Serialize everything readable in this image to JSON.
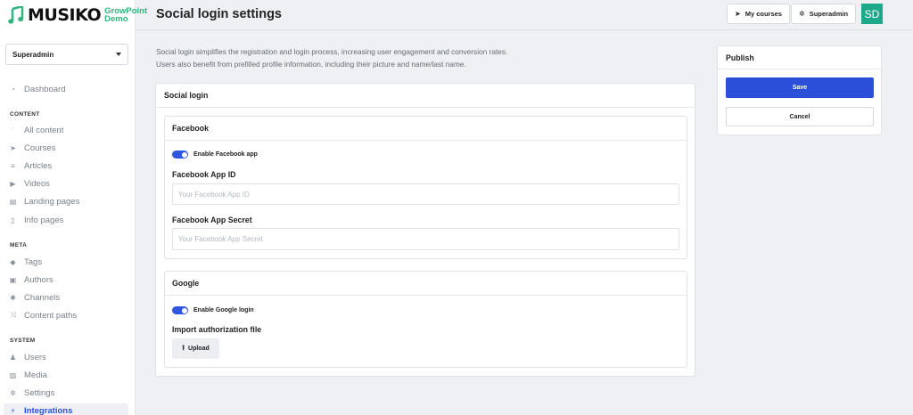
{
  "brand": {
    "name": "MUSIKO",
    "sub1": "GrowPoint",
    "sub2": "Demo"
  },
  "workspace": {
    "selected": "Superadmin"
  },
  "nav": {
    "dashboard": {
      "label": "Dashboard",
      "icon": "dashboard-icon"
    },
    "sections": {
      "content": "CONTENT",
      "meta": "META",
      "system": "SYSTEM"
    },
    "content_items": [
      {
        "label": "All content",
        "icon": "rss-icon"
      },
      {
        "label": "Courses",
        "icon": "paper-plane-icon"
      },
      {
        "label": "Articles",
        "icon": "lines-icon"
      },
      {
        "label": "Videos",
        "icon": "play-icon"
      },
      {
        "label": "Landing pages",
        "icon": "layout-icon"
      },
      {
        "label": "Info pages",
        "icon": "file-icon"
      }
    ],
    "meta_items": [
      {
        "label": "Tags",
        "icon": "tag-icon"
      },
      {
        "label": "Authors",
        "icon": "id-card-icon"
      },
      {
        "label": "Channels",
        "icon": "asterisk-icon"
      },
      {
        "label": "Content paths",
        "icon": "shuffle-icon"
      }
    ],
    "system_items": [
      {
        "label": "Users",
        "icon": "user-icon"
      },
      {
        "label": "Media",
        "icon": "image-icon"
      },
      {
        "label": "Settings",
        "icon": "gear-icon"
      },
      {
        "label": "Integrations",
        "icon": "plug-icon",
        "active": true
      }
    ]
  },
  "header": {
    "title": "Social login settings",
    "my_courses": "My courses",
    "superadmin": "Superadmin",
    "avatar_initials": "SD"
  },
  "intro": {
    "line1": "Social login simplifies the registration and login process, increasing user engagement and conversion rates.",
    "line2": "Users also benefit from prefilled profile information, including their picture and name/last name."
  },
  "social_login": {
    "title": "Social login",
    "facebook": {
      "title": "Facebook",
      "toggle_label": "Enable Facebook app",
      "enabled": true,
      "app_id_label": "Facebook App ID",
      "app_id_value": "",
      "app_id_placeholder": "Your Facebook App ID",
      "app_secret_label": "Facebook App Secret",
      "app_secret_value": "",
      "app_secret_placeholder": "Your Facebook App Secret"
    },
    "google": {
      "title": "Google",
      "toggle_label": "Enable Google login",
      "enabled": true,
      "import_label": "Import authorization file",
      "upload_label": "Upload"
    }
  },
  "publish": {
    "title": "Publish",
    "save": "Save",
    "cancel": "Cancel"
  },
  "colors": {
    "accent": "#2b4fd8",
    "brand_green": "#2fb57d",
    "avatar": "#1fa98b"
  }
}
